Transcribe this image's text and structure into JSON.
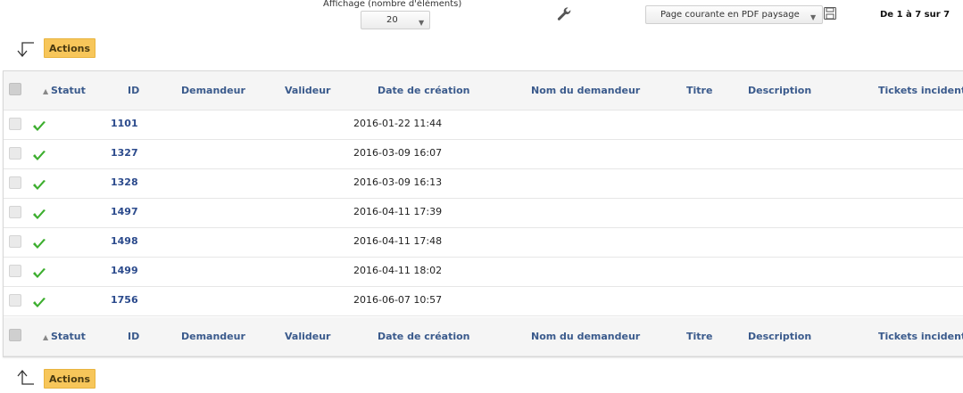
{
  "toolbar": {
    "display_label": "Affichage (nombre d'éléments)",
    "display_value": "20",
    "export_value": "Page courante en PDF paysage",
    "pager_text": "De 1 à 7 sur 7"
  },
  "actions_label": "Actions",
  "columns": {
    "status": "Statut",
    "id": "ID",
    "requester": "Demandeur",
    "validator": "Valideur",
    "created": "Date de création",
    "requester_name": "Nom du demandeur",
    "title": "Titre",
    "description": "Description",
    "tickets": "Tickets incident"
  },
  "rows": [
    {
      "id": "1101",
      "date": "2016-01-22 11:44",
      "status_icon": "check-icon"
    },
    {
      "id": "1327",
      "date": "2016-03-09 16:07",
      "status_icon": "check-icon"
    },
    {
      "id": "1328",
      "date": "2016-03-09 16:13",
      "status_icon": "check-icon"
    },
    {
      "id": "1497",
      "date": "2016-04-11 17:39",
      "status_icon": "check-icon"
    },
    {
      "id": "1498",
      "date": "2016-04-11 17:48",
      "status_icon": "check-icon"
    },
    {
      "id": "1499",
      "date": "2016-04-11 18:02",
      "status_icon": "check-icon"
    },
    {
      "id": "1756",
      "date": "2016-06-07 10:57",
      "status_icon": "check-icon"
    }
  ],
  "colors": {
    "actions_bg": "#f7c65a",
    "header_text": "#3a5a8c",
    "check_green": "#3cae2e"
  }
}
